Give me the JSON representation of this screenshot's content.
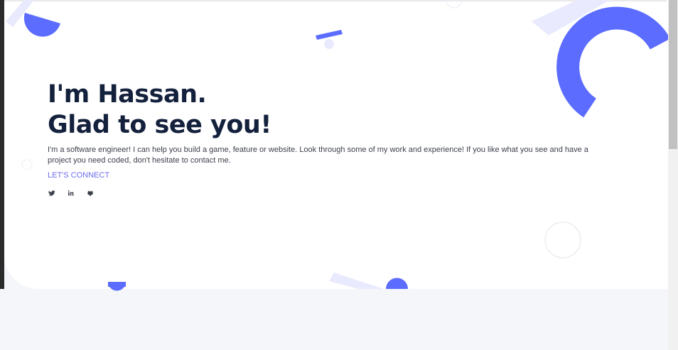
{
  "hero": {
    "title_line1": "I'm Hassan.",
    "title_line2": "Glad to see you!",
    "intro": "I'm a software engineer! I can help you build a game, feature or website. Look through some of my work and experience! If you like what you see and have a project you need coded, don't hesitate to contact me.",
    "cta_label": "LET'S CONNECT"
  },
  "socials": [
    {
      "icon": "twitter-icon"
    },
    {
      "icon": "linkedin-icon"
    },
    {
      "icon": "github-icon"
    }
  ],
  "colors": {
    "accent": "#5b6cff",
    "accent_light": "#e9eafd",
    "heading": "#14213d",
    "link": "#6c6cf0",
    "background": "#f5f6fa"
  }
}
